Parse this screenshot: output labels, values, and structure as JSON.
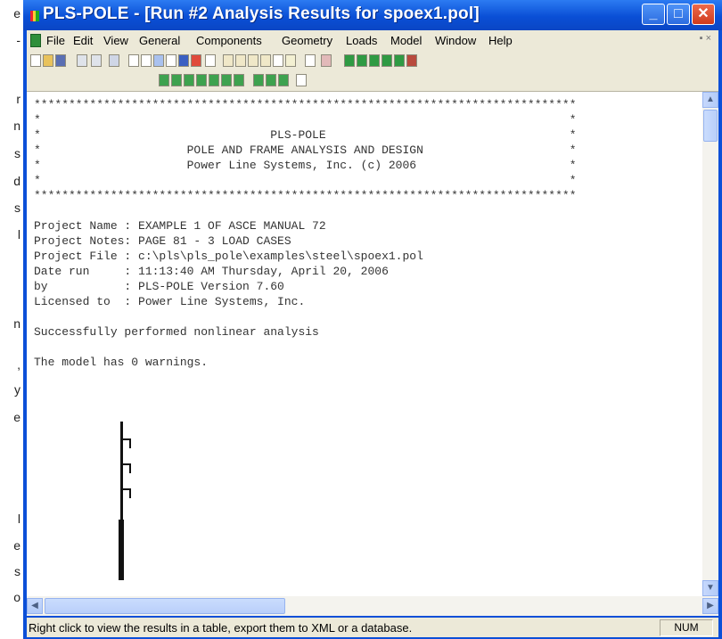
{
  "page_edge_fragments": [
    "e",
    "-",
    "r",
    "n",
    "s",
    "d",
    "s",
    "l",
    "n",
    ",",
    "y",
    "e",
    "l",
    "e",
    "s",
    "o"
  ],
  "window": {
    "title": "PLS-POLE - [Run #2 Analysis Results for spoex1.pol]",
    "controls": {
      "minimize": "_",
      "maximize": "□",
      "close": "✕"
    }
  },
  "menubar": {
    "items": [
      "File",
      "Edit",
      "View",
      "General",
      "Components",
      "Geometry",
      "Loads",
      "Model",
      "Window",
      "Help"
    ],
    "mdi_controls": "▪ ×"
  },
  "report": {
    "border_line": "******************************************************************************",
    "header_lines": [
      "*                                                                            *",
      "*                                 PLS-POLE                                   *",
      "*                     POLE AND FRAME ANALYSIS AND DESIGN                     *",
      "*                     Power Line Systems, Inc. (c) 2006                      *",
      "*                                                                            *"
    ],
    "info_lines": [
      "Project Name : EXAMPLE 1 OF ASCE MANUAL 72",
      "Project Notes: PAGE 81 - 3 LOAD CASES",
      "Project File : c:\\pls\\pls_pole\\examples\\steel\\spoex1.pol",
      "Date run     : 11:13:40 AM Thursday, April 20, 2006",
      "by           : PLS-POLE Version 7.60",
      "Licensed to  : Power Line Systems, Inc."
    ],
    "result_line": "Successfully performed nonlinear analysis",
    "warnings_line": "The model has 0 warnings."
  },
  "statusbar": {
    "hint": "Right click to view the results in a table, export them to XML or a database.",
    "indicator": "NUM"
  },
  "colors": {
    "title_blue": "#0a4fd6",
    "chrome_beige": "#ece9d8",
    "close_red": "#cf3b1d"
  }
}
